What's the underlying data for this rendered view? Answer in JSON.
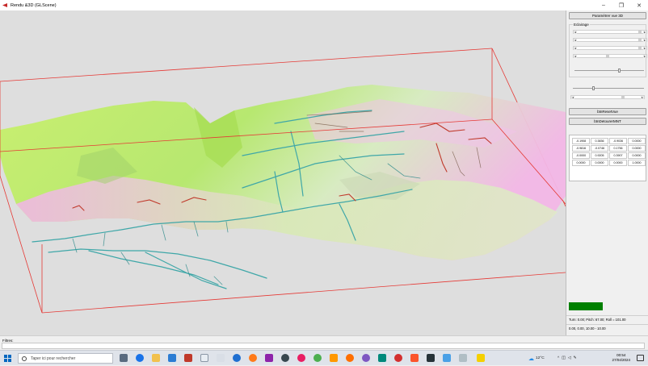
{
  "window": {
    "title": "Rendu &3D (GLScene)",
    "minimize": "–",
    "maximize": "❐",
    "close": "✕"
  },
  "panel": {
    "param_button": "Paramètrer vue 3D",
    "lighting_group": "Eclairage",
    "reset_button": "btnResetVue",
    "detourer_button": "btnDetourerMNT",
    "matrix": [
      [
        "-0.1908",
        "0.3836",
        "-0.9036",
        "0.0000"
      ],
      [
        "-0.9816",
        "-0.0746",
        "0.1756",
        "0.0000"
      ],
      [
        "-0.0000",
        "0.9205",
        "0.3907",
        "0.0000"
      ],
      [
        "0.0000",
        "0.0000",
        "0.0000",
        "1.0000"
      ]
    ],
    "status_turn": "Turn: 0.00; Pitch: 67.00; Roll = 101.00",
    "status_coords": "0.00, 0.00, 10.00 - 10.00"
  },
  "filter": {
    "label": "Filtres:"
  },
  "taskbar": {
    "search_placeholder": "Taper ici pour rechercher",
    "temperature": "12°C",
    "time": "00:54",
    "date": "27/04/2024"
  },
  "colors": {
    "bounding_box": "#e53935",
    "terrain_green": "#b5e86a",
    "terrain_pink": "#f3b7e6",
    "cave_cyan": "#3fa7a8",
    "cave_red": "#c0392b",
    "indicator": "#008000"
  }
}
